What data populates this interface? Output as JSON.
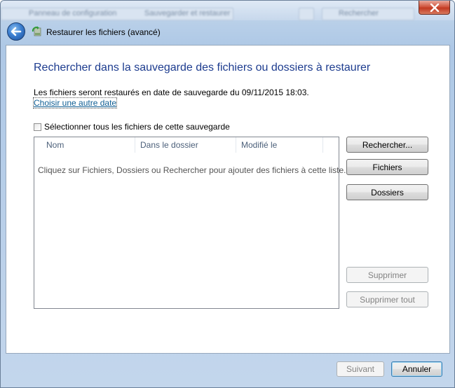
{
  "title_bar": {
    "breadcrumb_blur_1": "Panneau de configuration",
    "breadcrumb_blur_2": "Sauvegarder et restaurer",
    "search_blur": "Rechercher"
  },
  "nav": {
    "window_title": "Restaurer les fichiers (avancé)"
  },
  "main": {
    "heading": "Rechercher dans la sauvegarde des fichiers ou dossiers à restaurer",
    "restore_info": "Les fichiers seront restaurés en date de sauvegarde du 09/11/2015 18:03.",
    "other_date_link": "Choisir une autre date",
    "select_all_label": "Sélectionner tous les fichiers de cette sauvegarde",
    "list": {
      "columns": [
        "Nom",
        "Dans le dossier",
        "Modifié le"
      ],
      "empty_message": "Cliquez sur Fichiers, Dossiers ou Rechercher pour ajouter des fichiers à cette liste."
    },
    "buttons": {
      "search": "Rechercher...",
      "files": "Fichiers",
      "folders": "Dossiers",
      "delete": "Supprimer",
      "delete_all": "Supprimer tout"
    }
  },
  "footer": {
    "next": "Suivant",
    "cancel": "Annuler"
  },
  "icons": {
    "back": "back-arrow-icon",
    "app": "backup-restore-icon",
    "close": "close-icon"
  },
  "colors": {
    "heading": "#1d3c8f",
    "link": "#0f5e94",
    "close_button": "#c23a22"
  }
}
